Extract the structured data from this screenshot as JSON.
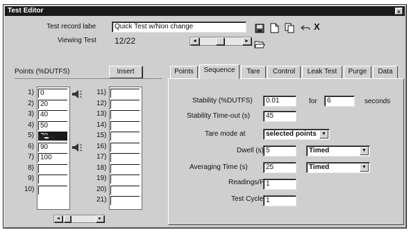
{
  "window": {
    "title": "Test Editor",
    "close_glyph": "×"
  },
  "header": {
    "record_label": "Test record labe",
    "record_value": "Quick Test w/Non change",
    "viewing_label": "Viewing Test",
    "viewing_value": "12/22"
  },
  "toolbar": {
    "icons": [
      "save-icon",
      "new-document-icon",
      "copy-icon",
      "undo-icon",
      "delete-icon"
    ],
    "delete_glyph": "X"
  },
  "points": {
    "title": "Points (%DUTFS)",
    "insert_label": "Insert",
    "left_rows": [
      {
        "n": "1)",
        "v": "0"
      },
      {
        "n": "2)",
        "v": "20"
      },
      {
        "n": "3)",
        "v": "40"
      },
      {
        "n": "4)",
        "v": "50"
      },
      {
        "n": "5)",
        "v": "70"
      },
      {
        "n": "6)",
        "v": "90"
      },
      {
        "n": "7)",
        "v": "100"
      },
      {
        "n": "8)",
        "v": ""
      },
      {
        "n": "9)",
        "v": ""
      },
      {
        "n": "10)",
        "v": ""
      }
    ],
    "right_rows": [
      {
        "n": "11)",
        "v": ""
      },
      {
        "n": "12)",
        "v": ""
      },
      {
        "n": "13)",
        "v": ""
      },
      {
        "n": "14)",
        "v": ""
      },
      {
        "n": "15)",
        "v": ""
      },
      {
        "n": "16)",
        "v": ""
      },
      {
        "n": "17)",
        "v": ""
      },
      {
        "n": "18)",
        "v": ""
      },
      {
        "n": "19)",
        "v": ""
      },
      {
        "n": "20)",
        "v": ""
      },
      {
        "n": "21)",
        "v": ""
      }
    ],
    "insert_marker_glyph": "▬"
  },
  "tabs": [
    "Points",
    "Sequence",
    "Tare",
    "Control",
    "Leak Test",
    "Purge",
    "Data"
  ],
  "active_tab": "Sequence",
  "sequence": {
    "stability_label": "Stability (%DUTFS)",
    "stability_value": "0.01",
    "for_label": "for",
    "for_value": "6",
    "seconds_label": "seconds",
    "stability_timeout_label": "Stability Time-out (s)",
    "stability_timeout_value": "45",
    "tare_label": "Tare mode at",
    "tare_value": "selected points",
    "dwell_label": "Dwell (s)",
    "dwell_value": "5",
    "dwell_mode": "Timed",
    "averaging_label": "Averaging Time (s)",
    "averaging_value": "25",
    "averaging_mode": "Timed",
    "readings_label": "Readings/Pt",
    "readings_value": "1",
    "cycles_label": "Test Cycles",
    "cycles_value": "1"
  },
  "colors": {
    "titlebar": "#1a1a1a",
    "face": "#cfcfcf",
    "field": "#ffffff"
  }
}
